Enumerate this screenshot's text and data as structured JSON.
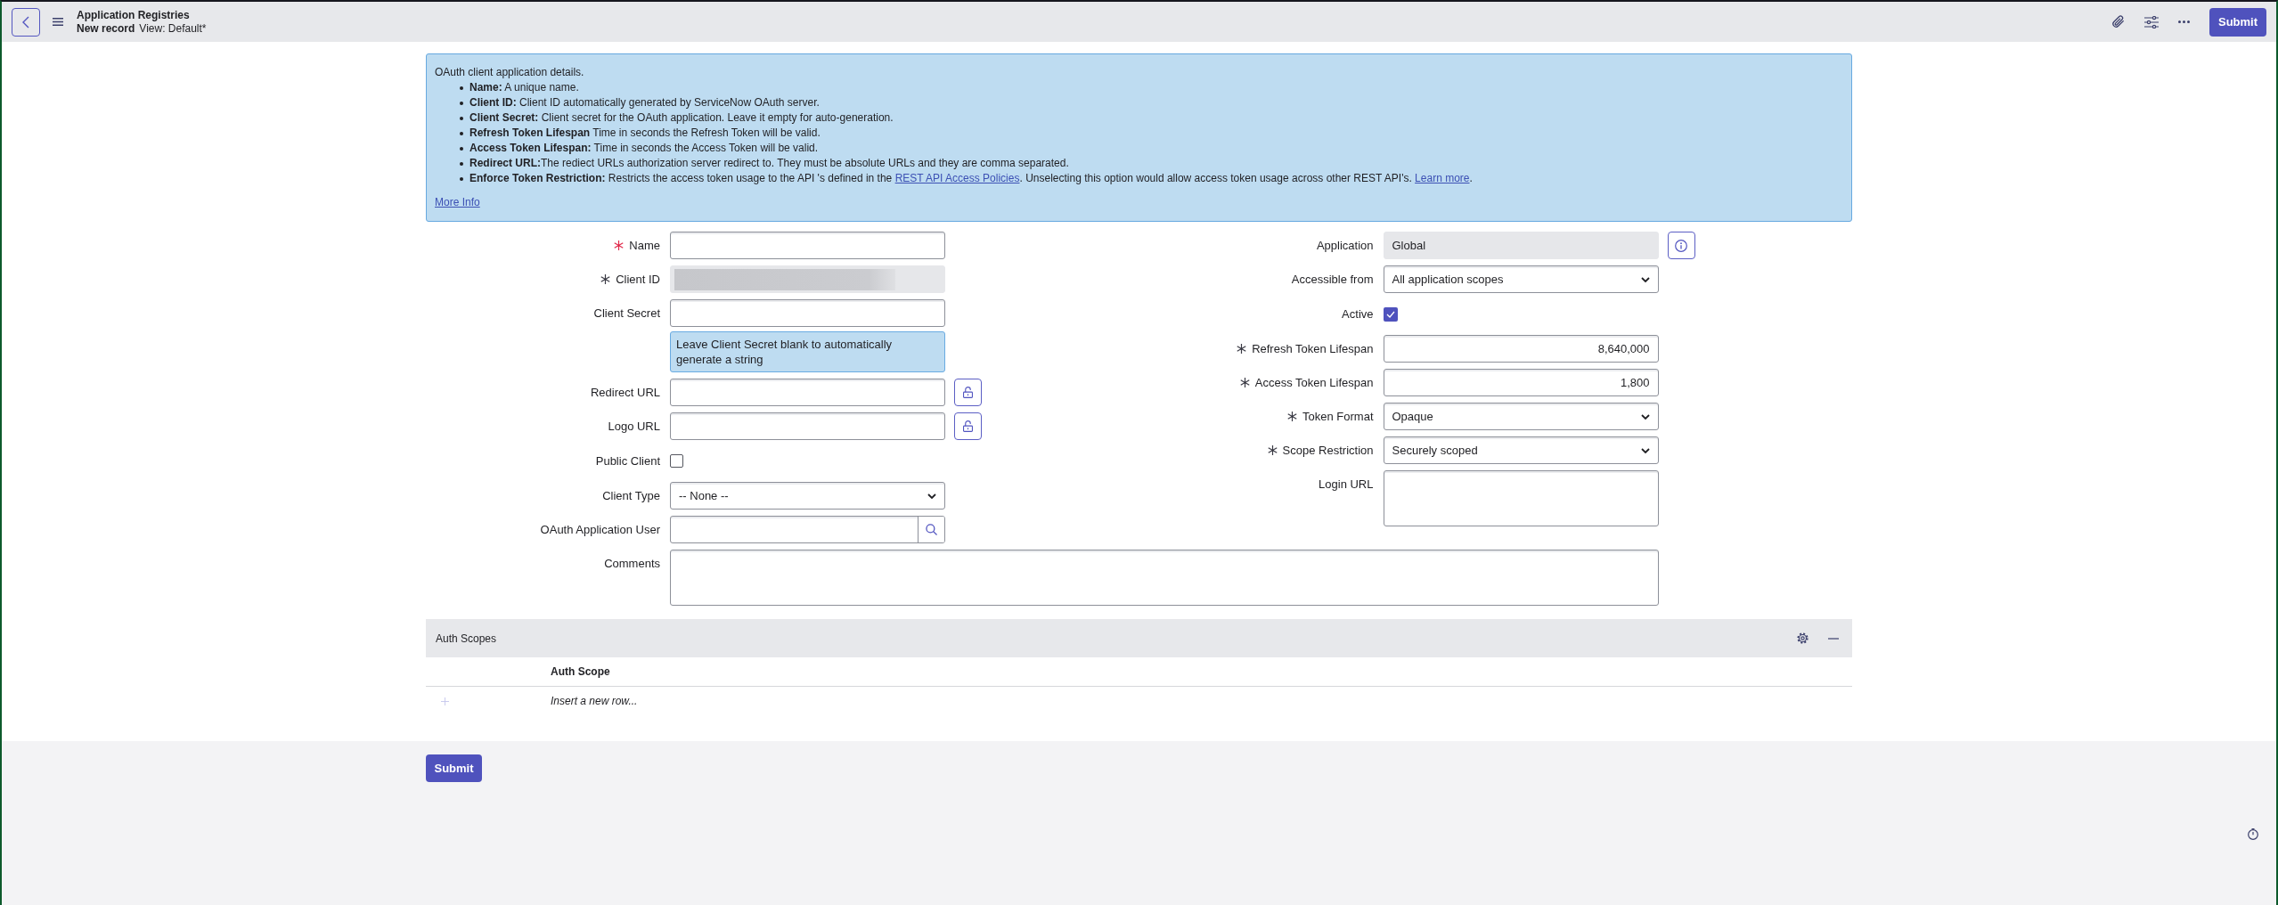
{
  "header": {
    "title": "Application Registries",
    "record": "New record",
    "view": "View: Default*",
    "submit": "Submit"
  },
  "info_box": {
    "intro": "OAuth client application details.",
    "items": [
      {
        "parts": [
          {
            "kind": "text",
            "text": "**Name:** A unique name."
          }
        ]
      },
      {
        "parts": [
          {
            "kind": "text",
            "text": "**Client ID:** Client ID automatically generated by ServiceNow OAuth server."
          }
        ]
      },
      {
        "parts": [
          {
            "kind": "text",
            "text": "**Client Secret:** Client secret for the OAuth application. Leave it empty for auto-generation."
          }
        ]
      },
      {
        "parts": [
          {
            "kind": "text",
            "text": "**Refresh Token Lifespan** Time in seconds the Refresh Token will be valid."
          }
        ]
      },
      {
        "parts": [
          {
            "kind": "text",
            "text": "**Access Token Lifespan:** Time in seconds the Access Token will be valid."
          }
        ]
      },
      {
        "parts": [
          {
            "kind": "text",
            "text": "**Redirect URL:**The rediect URLs authorization server redirect to. They must be absolute URLs and they are comma separated."
          }
        ]
      },
      {
        "parts": [
          {
            "kind": "text",
            "text": "**Enforce Token Restriction:** Restricts the access token usage to the API 's defined in the "
          },
          {
            "kind": "link",
            "text": "REST API Access Policies"
          },
          {
            "kind": "text",
            "text": ". Unselecting this option would allow access token usage across other REST API's. "
          },
          {
            "kind": "link",
            "text": "Learn more"
          },
          {
            "kind": "text",
            "text": "."
          }
        ]
      }
    ],
    "more_info": "More Info"
  },
  "form": {
    "left_fields": [
      {
        "label": "Name",
        "kind": "text",
        "required": true,
        "missing": true
      },
      {
        "label": "Client ID",
        "kind": "redacted",
        "required": true,
        "missing": false
      },
      {
        "label": "Client Secret",
        "kind": "text",
        "required": false,
        "missing": false,
        "hint": "Leave Client Secret blank to automatically generate a string"
      },
      {
        "label": "Redirect URL",
        "kind": "text",
        "required": false,
        "missing": false,
        "addon": {
          "kind": "lock"
        }
      },
      {
        "label": "Logo URL",
        "kind": "text",
        "required": false,
        "missing": false,
        "addon": {
          "kind": "lock"
        }
      },
      {
        "label": "Public Client",
        "kind": "checkbox",
        "required": false,
        "missing": false,
        "checked": false
      },
      {
        "label": "Client Type",
        "kind": "select",
        "required": false,
        "missing": false,
        "value": "-- None --"
      },
      {
        "label": "OAuth Application User",
        "kind": "reference",
        "required": false,
        "missing": false
      }
    ],
    "right_fields": [
      {
        "label": "Application",
        "kind": "readonly",
        "required": false,
        "missing": false,
        "value": "Global",
        "addon": {
          "kind": "info"
        }
      },
      {
        "label": "Accessible from",
        "kind": "select",
        "required": false,
        "missing": false,
        "value": "All application scopes"
      },
      {
        "label": "Active",
        "kind": "checkbox",
        "required": false,
        "missing": false,
        "checked": true
      },
      {
        "label": "Refresh Token Lifespan",
        "kind": "number",
        "required": true,
        "missing": false,
        "value": "8,640,000"
      },
      {
        "label": "Access Token Lifespan",
        "kind": "number",
        "required": true,
        "missing": false,
        "value": "1,800"
      },
      {
        "label": "Token Format",
        "kind": "select",
        "required": true,
        "missing": false,
        "value": "Opaque"
      },
      {
        "label": "Scope Restriction",
        "kind": "select",
        "required": true,
        "missing": false,
        "value": "Securely scoped"
      },
      {
        "label": "Login URL",
        "kind": "textarea",
        "required": false,
        "missing": false
      }
    ],
    "wide_fields": [
      {
        "label": "Comments",
        "kind": "textarea",
        "required": false,
        "missing": false
      }
    ]
  },
  "related_list": {
    "title": "Auth Scopes",
    "columns": [
      "Auth Scope"
    ],
    "insert_row": "Insert a new row..."
  },
  "footer": {
    "submit": "Submit"
  }
}
